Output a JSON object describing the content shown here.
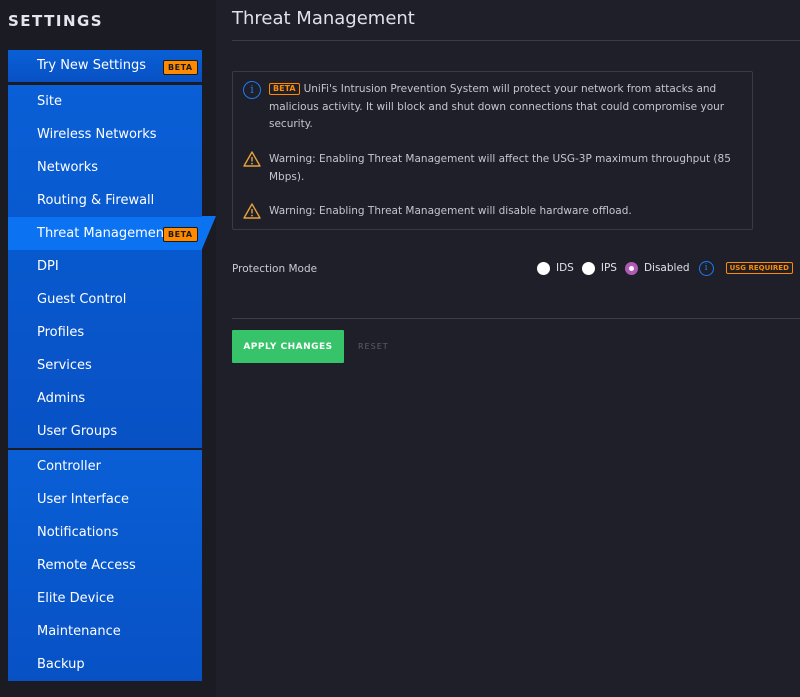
{
  "sidebar": {
    "title": "SETTINGS",
    "try_new": {
      "label": "Try New Settings",
      "badge": "BETA"
    },
    "items": [
      {
        "label": "Site"
      },
      {
        "label": "Wireless Networks"
      },
      {
        "label": "Networks"
      },
      {
        "label": "Routing & Firewall"
      },
      {
        "label": "Threat Management",
        "badge": "BETA",
        "active": true
      },
      {
        "label": "DPI"
      },
      {
        "label": "Guest Control"
      },
      {
        "label": "Profiles"
      },
      {
        "label": "Services"
      },
      {
        "label": "Admins"
      },
      {
        "label": "User Groups"
      }
    ],
    "items2": [
      {
        "label": "Controller"
      },
      {
        "label": "User Interface"
      },
      {
        "label": "Notifications"
      },
      {
        "label": "Remote Access"
      },
      {
        "label": "Elite Device"
      },
      {
        "label": "Maintenance"
      },
      {
        "label": "Backup"
      }
    ]
  },
  "main": {
    "title": "Threat Management",
    "info": {
      "beta_badge": "BETA",
      "intro": "UniFi's Intrusion Prevention System will protect your network from attacks and malicious activity. It will block and shut down connections that could compromise your security.",
      "warning1": "Warning: Enabling Threat Management will affect the USG-3P maximum throughput (85 Mbps).",
      "warning2": "Warning: Enabling Threat Management will disable hardware offload."
    },
    "protection_mode": {
      "label": "Protection Mode",
      "options": [
        "IDS",
        "IPS",
        "Disabled"
      ],
      "selected": "Disabled",
      "badge": "USG REQUIRED"
    },
    "apply_label": "APPLY CHANGES",
    "reset_label": "RESET"
  },
  "colors": {
    "accent_blue": "#0a5fd6",
    "active_blue": "#0b73f2",
    "beta_orange": "#ff8a00",
    "apply_green": "#36c36a",
    "background": "#1e1f29"
  }
}
